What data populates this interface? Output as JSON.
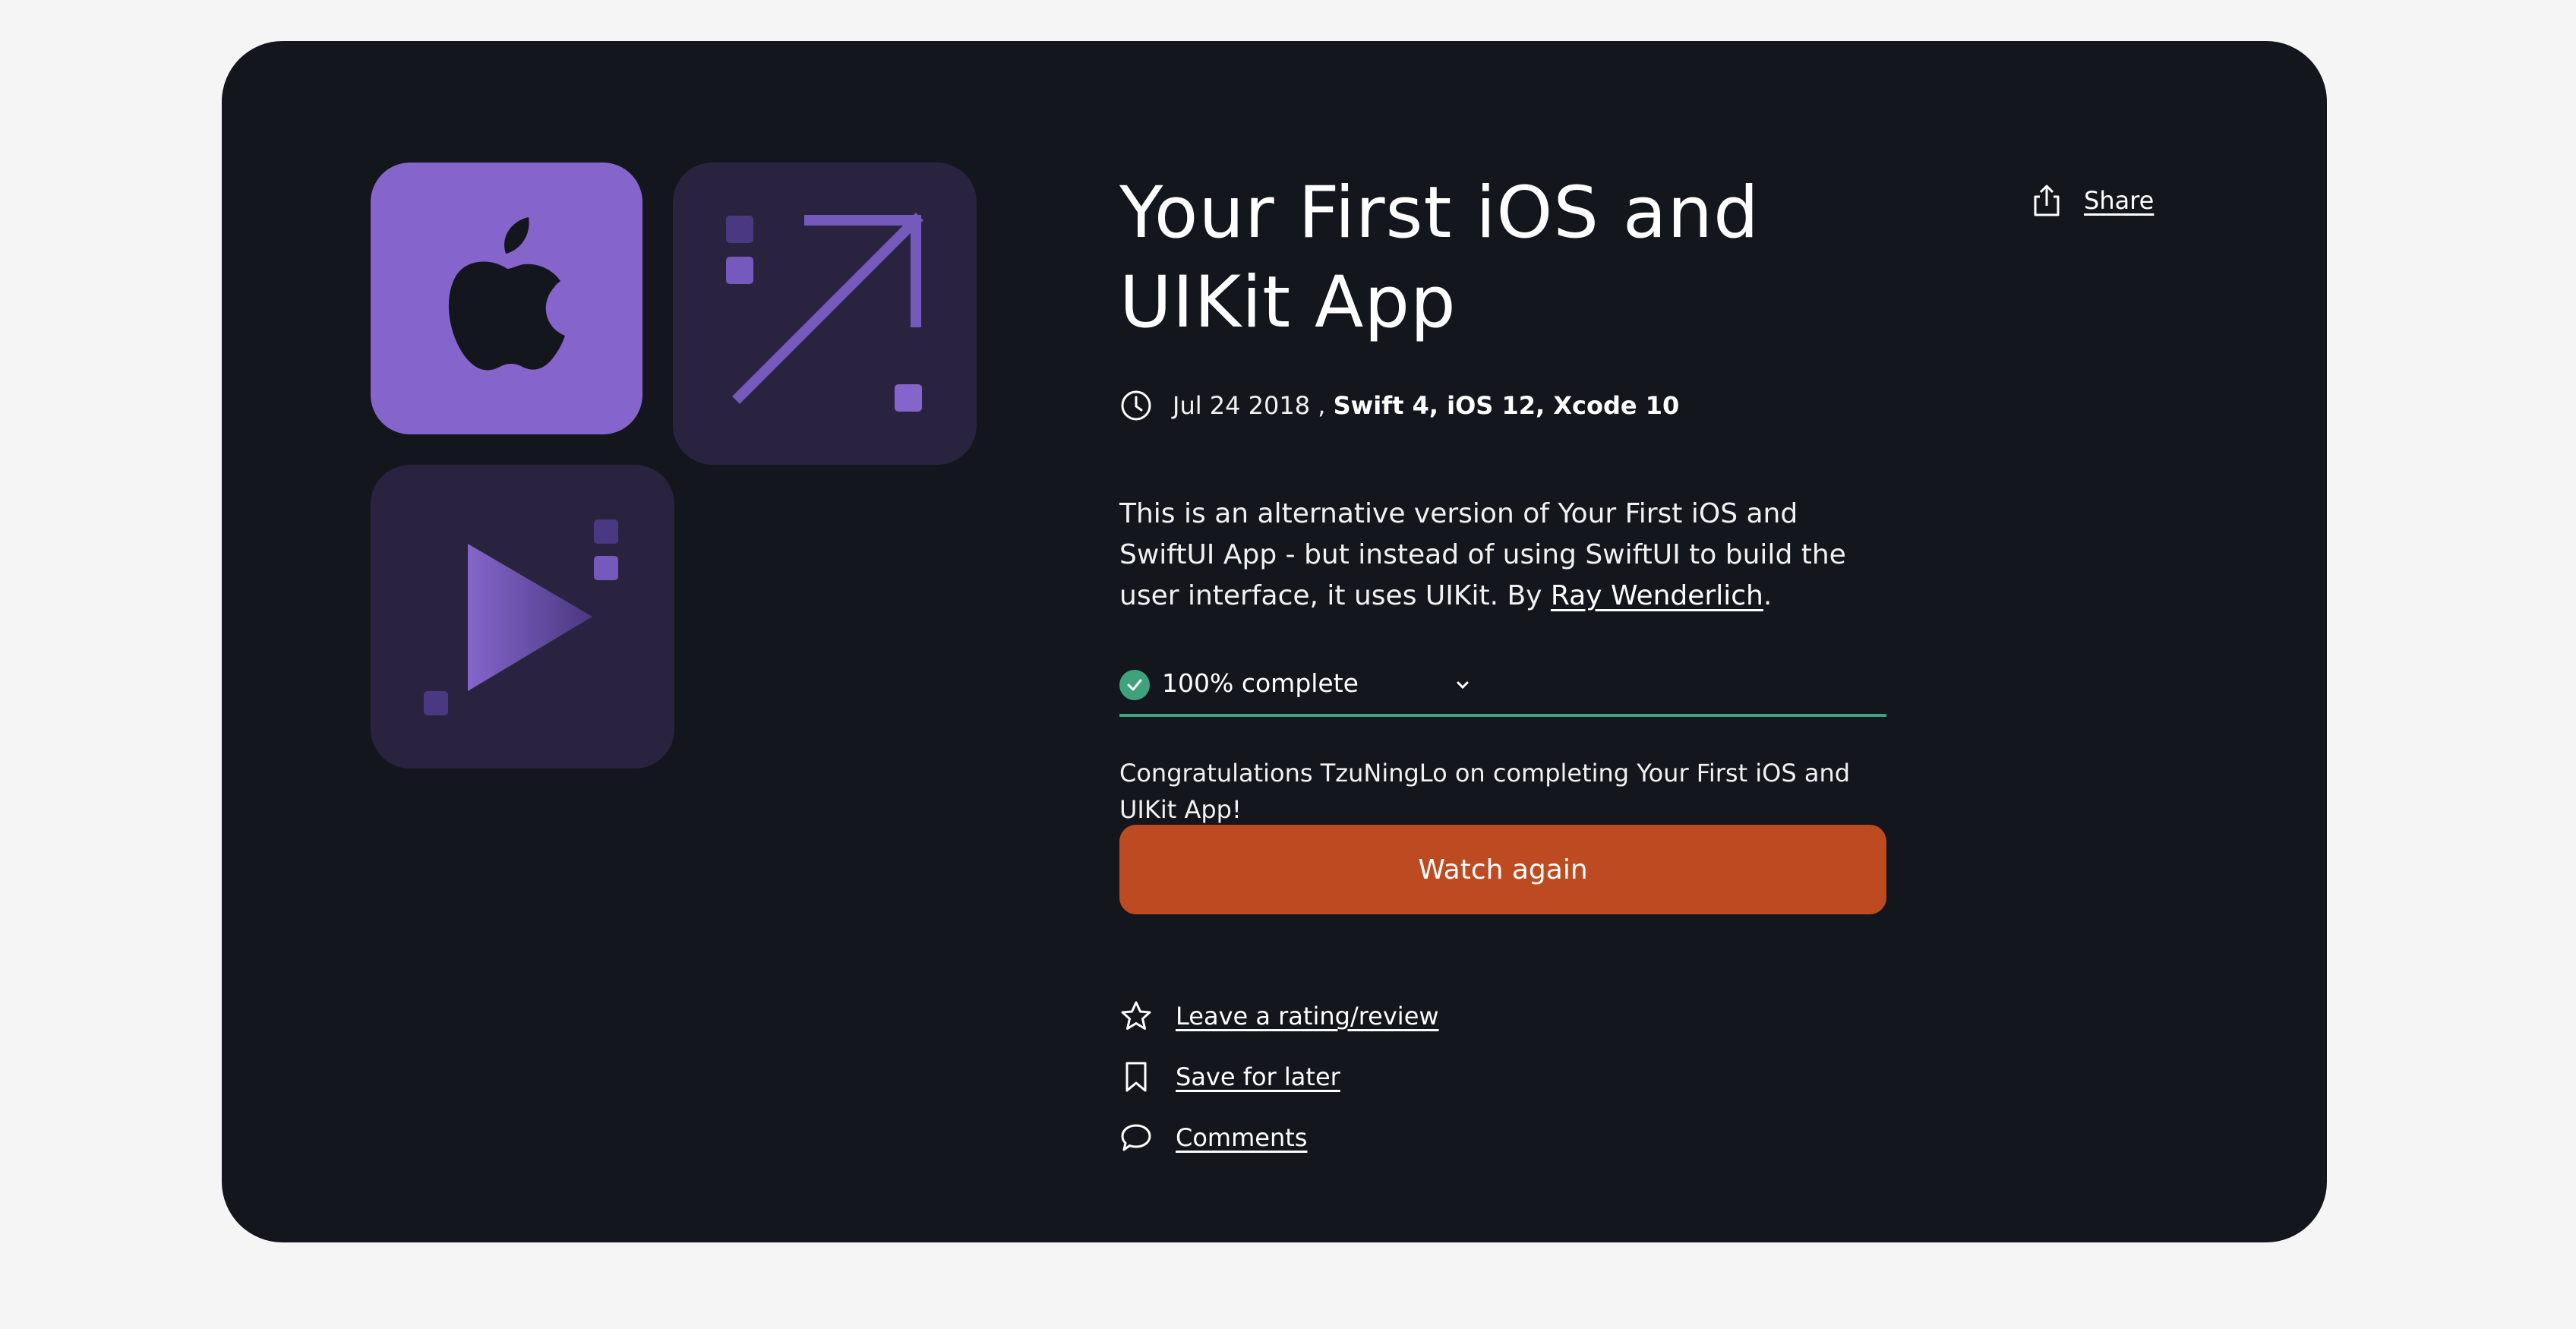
{
  "course": {
    "title": "Your First iOS and UIKit App",
    "date": "Jul 24 2018",
    "separator": " , ",
    "versions": "Swift 4, iOS 12, Xcode 10",
    "description_before": "This is an alternative version of Your First iOS and SwiftUI App - but instead of using SwiftUI to build the user interface, it uses UIKit. By ",
    "author": "Ray Wenderlich",
    "description_after": "."
  },
  "progress": {
    "label": "100% complete",
    "percent": 100
  },
  "congrats": "Congratulations TzuNingLo on completing Your First iOS and UIKit App!",
  "primary_button": "Watch again",
  "actions": [
    {
      "label": "Leave a rating/review",
      "icon": "star-icon"
    },
    {
      "label": "Save for later",
      "icon": "bookmark-icon"
    },
    {
      "label": "Comments",
      "icon": "comment-icon"
    }
  ],
  "share": {
    "label": "Share",
    "icon": "share-icon"
  },
  "colors": {
    "card_background": "#13161d",
    "accent_purple": "#8565cb",
    "tile_dark": "#2a2340",
    "progress_green": "#3ea37c",
    "button_orange": "#bd4a21"
  }
}
